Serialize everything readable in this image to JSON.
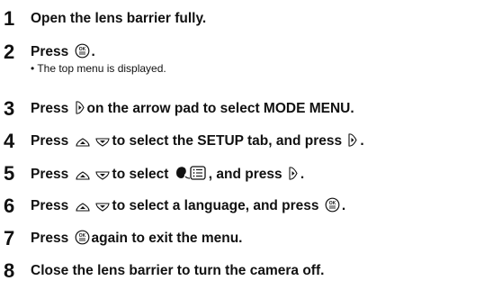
{
  "steps": [
    {
      "num": "1",
      "t1": "Open the lens barrier fully."
    },
    {
      "num": "2",
      "t1": "Press",
      "t2": ".",
      "sub": "• The top menu is displayed."
    },
    {
      "num": "3",
      "t1": "Press",
      "t2": "on the arrow pad to select MODE MENU."
    },
    {
      "num": "4",
      "t1": "Press",
      "t2": "to select the SETUP tab, and press",
      "t3": "."
    },
    {
      "num": "5",
      "t1": "Press",
      "t2": "to select",
      "t3": ", and press",
      "t4": "."
    },
    {
      "num": "6",
      "t1": "Press",
      "t2": "to select a language, and press",
      "t3": "."
    },
    {
      "num": "7",
      "t1": "Press",
      "t2": "again to exit the menu."
    },
    {
      "num": "8",
      "t1": "Close the lens barrier to turn the camera off."
    }
  ],
  "icons": {
    "ok": "ok-button-icon",
    "right": "arrow-right-icon",
    "up": "arrow-up-icon",
    "down": "arrow-down-icon",
    "language": "language-menu-icon"
  }
}
